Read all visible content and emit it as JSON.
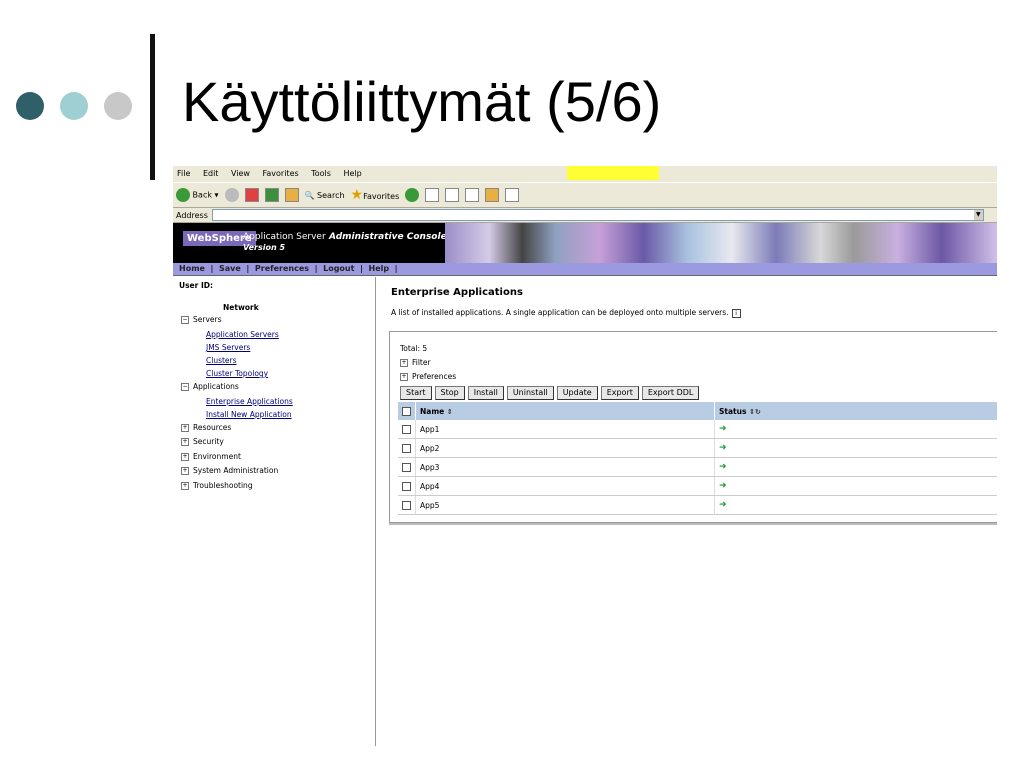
{
  "slide": {
    "title": "Käyttöliittymät (5/6)"
  },
  "browser": {
    "menu": [
      "File",
      "Edit",
      "View",
      "Favorites",
      "Tools",
      "Help"
    ],
    "toolbar": {
      "back": "Back",
      "search": "Search",
      "favorites": "Favorites"
    },
    "address_label": "Address"
  },
  "console": {
    "logo": "WebSphere",
    "product": "Application Server",
    "version": "Version 5",
    "admin": "Administrative Console",
    "nav": [
      "Home",
      "Save",
      "Preferences",
      "Logout",
      "Help"
    ]
  },
  "sidebar": {
    "user_id_label": "User ID:",
    "network_label": "Network",
    "servers": "Servers",
    "server_links": [
      "Application Servers",
      "JMS Servers",
      "Clusters",
      "Cluster Topology"
    ],
    "applications": "Applications",
    "application_links": [
      "Enterprise Applications",
      "Install New Application"
    ],
    "collapsed": [
      "Resources",
      "Security",
      "Environment",
      "System Administration",
      "Troubleshooting"
    ]
  },
  "main": {
    "title": "Enterprise Applications",
    "description": "A list of installed applications. A single application can be deployed onto multiple servers.",
    "total": "Total: 5",
    "filter": "Filter",
    "preferences": "Preferences",
    "buttons": [
      "Start",
      "Stop",
      "Install",
      "Uninstall",
      "Update",
      "Export",
      "Export DDL"
    ],
    "columns": [
      "Name",
      "Status"
    ],
    "rows": [
      "App1",
      "App2",
      "App3",
      "App4",
      "App5"
    ],
    "status_color": "#1a9a3a"
  }
}
